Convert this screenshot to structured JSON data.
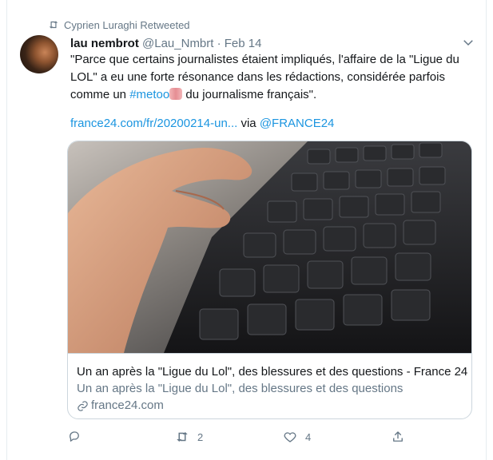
{
  "retweet": {
    "label": "Cyprien Luraghi Retweeted",
    "icon": "retweet-icon"
  },
  "tweet": {
    "author_name": "lau nembrot",
    "handle_date": " @Lau_Nmbrt · Feb 14",
    "text_before_hashtag": "\"Parce que certains journalistes étaient impliqués, l'affaire de la \"Ligue du\nLOL\" a eu une forte résonance dans les rédactions, considérée parfois\ncomme un ",
    "hashtag": "#metoo",
    "emoji": "crossed-fingers-emoji",
    "text_after_hashtag": " du journalisme français\".",
    "link": "france24.com/fr/20200214-un...",
    "via": " via ",
    "via_handle": "@FRANCE24"
  },
  "card": {
    "image": "keyboard-photo",
    "title": "Un an après la \"Ligue du Lol\", des blessures et des questions - France 24",
    "description": "Un an après la \"Ligue du Lol\", des blessures et des questions",
    "domain": "france24.com"
  },
  "actions": {
    "reply": {
      "icon": "reply-icon",
      "count": ""
    },
    "retweet": {
      "icon": "retweet-icon",
      "count": "2"
    },
    "like": {
      "icon": "heart-icon",
      "count": "4"
    },
    "share": {
      "icon": "share-icon"
    }
  },
  "colors": {
    "link": "#1b95e0",
    "secondary": "#657786",
    "text": "#14171a",
    "border": "#ccd6dd"
  }
}
